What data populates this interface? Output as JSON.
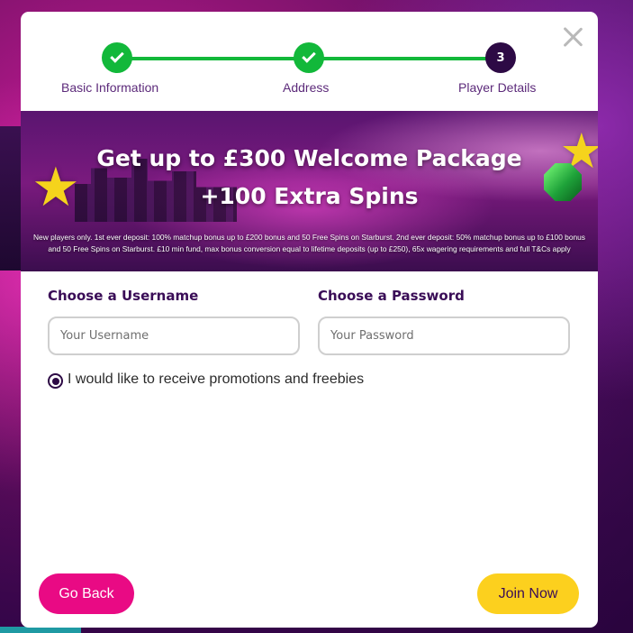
{
  "stepper": {
    "steps": [
      {
        "label": "Basic Information",
        "status": "done"
      },
      {
        "label": "Address",
        "status": "done"
      },
      {
        "label": "Player Details",
        "status": "current",
        "number": "3"
      }
    ],
    "colors": {
      "done": "#12b83a",
      "current": "#2d0a45"
    }
  },
  "banner": {
    "headline_line1": "Get up to £300 Welcome Package",
    "headline_line2": "+100 Extra Spins",
    "terms": "New players only. 1st ever deposit: 100% matchup bonus up to £200 bonus and 50 Free Spins on Starburst. 2nd ever deposit: 50% matchup bonus up to £100 bonus and 50 Free Spins on Starburst. £10 min fund, max bonus conversion equal to lifetime deposits (up to £250), 65x wagering requirements and full T&Cs apply"
  },
  "form": {
    "username_label": "Choose a Username",
    "username_placeholder": "Your Username",
    "username_value": "",
    "password_label": "Choose a Password",
    "password_placeholder": "Your Password",
    "password_value": "",
    "promotions_label": "I would like to receive promotions and freebies",
    "promotions_checked": true
  },
  "buttons": {
    "back_label": "Go Back",
    "join_label": "Join Now"
  },
  "icons": {
    "close": "close-icon",
    "check": "checkmark-icon"
  },
  "colors": {
    "back_button": "#e90a84",
    "join_button": "#fcd01e",
    "heading": "#3a0d57"
  }
}
